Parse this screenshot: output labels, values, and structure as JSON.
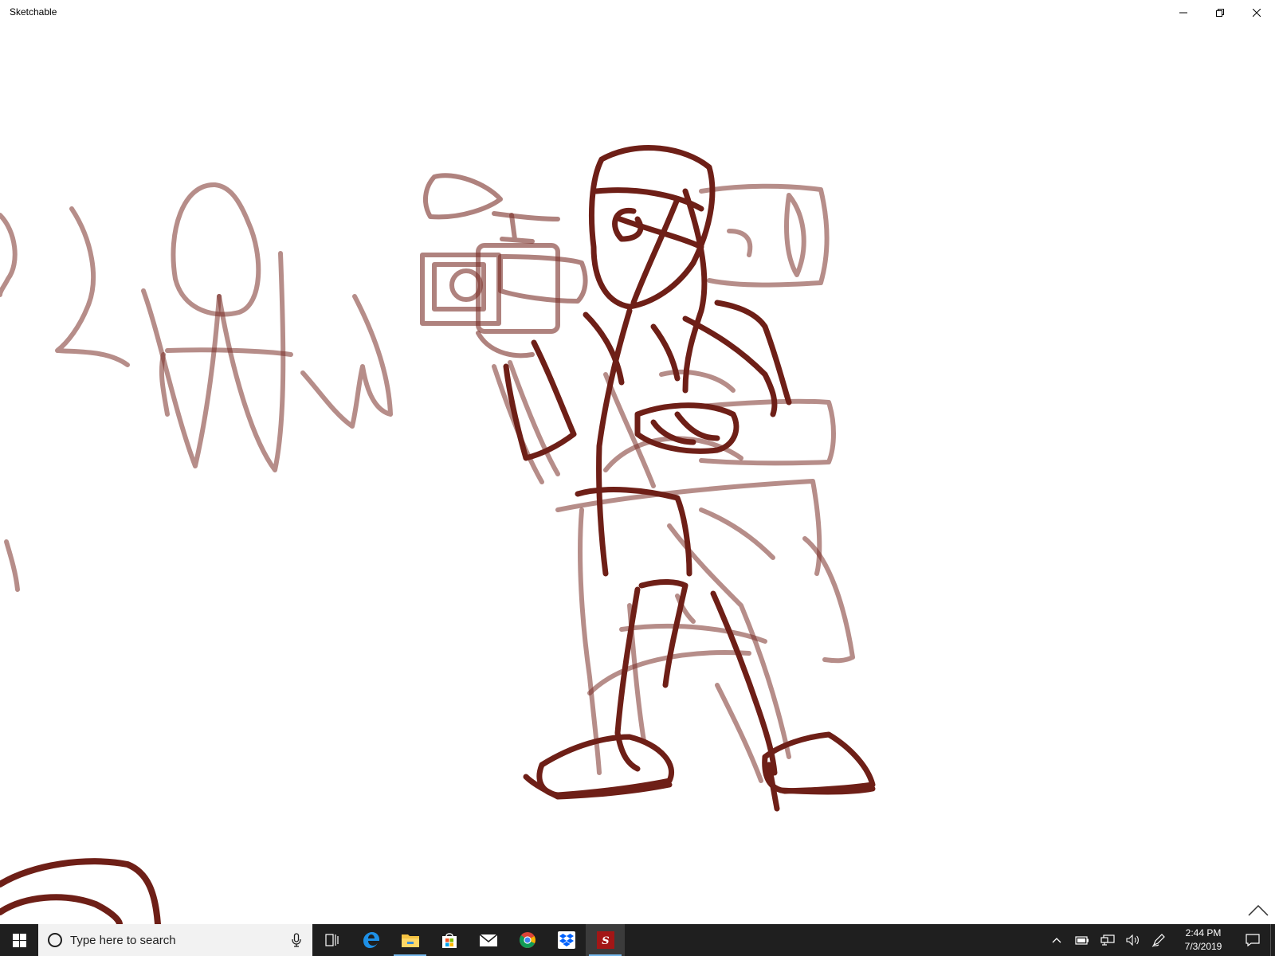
{
  "window": {
    "title": "Sketchable",
    "controls": {
      "minimize_icon": "minimize-icon",
      "restore_icon": "restore-icon",
      "close_icon": "close-icon"
    }
  },
  "canvas": {
    "ink_color": "#6e1f17",
    "background": "#ffffff",
    "expand_icon": "chevron-up-icon"
  },
  "taskbar": {
    "start_icon": "windows-logo-icon",
    "search": {
      "placeholder": "Type here to search",
      "icon": "cortana-circle-icon",
      "mic_icon": "microphone-icon"
    },
    "apps": [
      {
        "name": "task-view",
        "icon": "task-view-icon"
      },
      {
        "name": "edge",
        "icon": "edge-icon"
      },
      {
        "name": "file-explorer",
        "icon": "folder-icon"
      },
      {
        "name": "store",
        "icon": "store-bag-icon"
      },
      {
        "name": "mail",
        "icon": "mail-icon"
      },
      {
        "name": "chrome",
        "icon": "chrome-icon"
      },
      {
        "name": "dropbox",
        "icon": "dropbox-icon"
      },
      {
        "name": "sketchable",
        "icon": "sketchable-icon",
        "glyph": "S"
      }
    ],
    "tray": {
      "icons": [
        "chevron-up-icon",
        "battery-icon",
        "network-icon",
        "volume-icon",
        "pen-icon"
      ],
      "time": "2:44 PM",
      "date": "7/3/2019",
      "notification_icon": "action-center-icon"
    }
  }
}
